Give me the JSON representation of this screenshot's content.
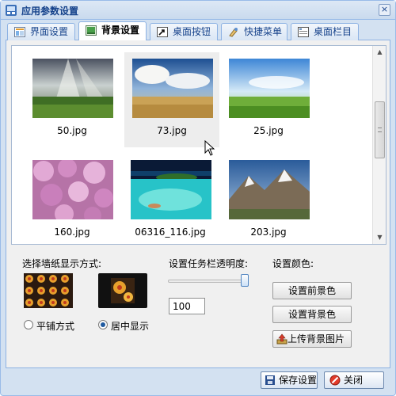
{
  "window": {
    "title": "应用参数设置",
    "close_label": "×"
  },
  "tabs": [
    {
      "label": "界面设置",
      "icon": "layout-icon",
      "active": false
    },
    {
      "label": "背景设置",
      "icon": "image-icon",
      "active": true
    },
    {
      "label": "桌面按钮",
      "icon": "shortcut-icon",
      "active": false
    },
    {
      "label": "快捷菜单",
      "icon": "menu-icon",
      "active": false
    },
    {
      "label": "桌面栏目",
      "icon": "column-icon",
      "active": false
    }
  ],
  "wallpapers": [
    {
      "file": "50.jpg",
      "scene": "sunbeams-field",
      "selected": false
    },
    {
      "file": "73.jpg",
      "scene": "desert-sky",
      "selected": true
    },
    {
      "file": "25.jpg",
      "scene": "green-meadow",
      "selected": false
    },
    {
      "file": "160.jpg",
      "scene": "pink-flowers",
      "selected": false
    },
    {
      "file": "06316_116.jpg",
      "scene": "tropical-island",
      "selected": false
    },
    {
      "file": "203.jpg",
      "scene": "snowy-mountains",
      "selected": false
    }
  ],
  "display_mode": {
    "heading": "选择墙纸显示方式:",
    "options": [
      {
        "label": "平铺方式",
        "checked": false
      },
      {
        "label": "居中显示",
        "checked": true
      }
    ]
  },
  "transparency": {
    "heading": "设置任务栏透明度:",
    "value": "100",
    "slider_fraction": 1.0
  },
  "colors": {
    "heading": "设置颜色:",
    "foreground_button": "设置前景色",
    "background_button": "设置背景色",
    "upload_button": "上传背景图片"
  },
  "footer": {
    "save_button": "保存设置",
    "close_button": "关闭"
  },
  "theme": {
    "accent": "#15428b",
    "border": "#99bbe8",
    "selected_bg": "#ededed"
  }
}
